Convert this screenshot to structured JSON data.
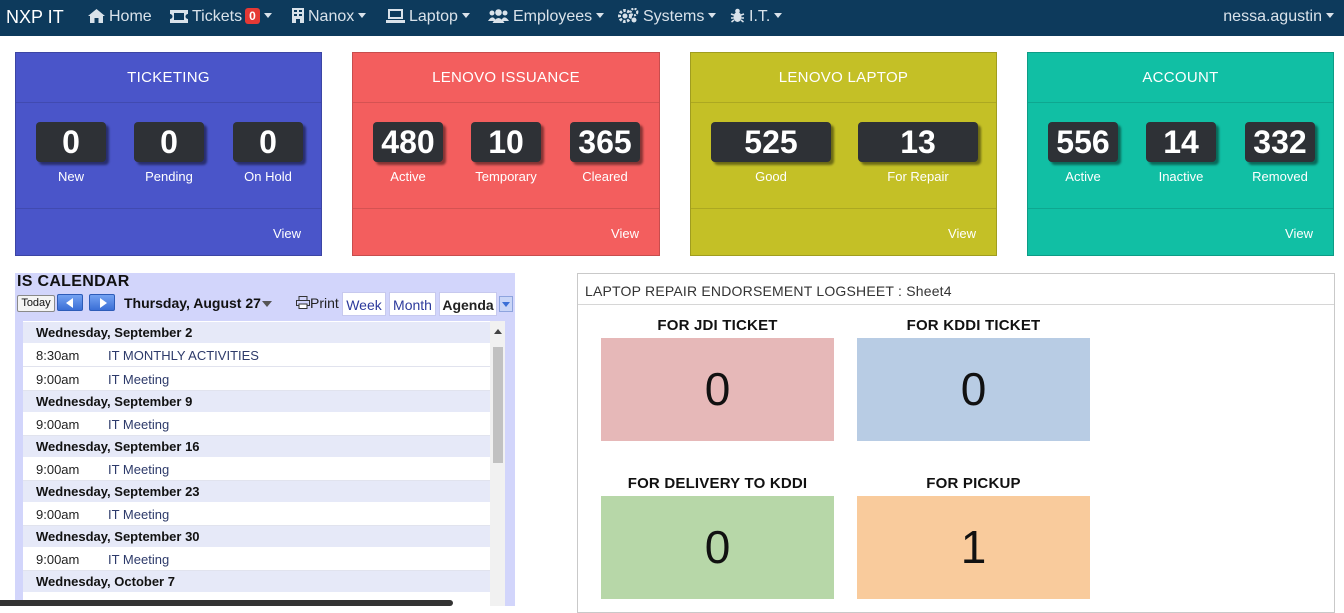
{
  "nav": {
    "brand": "NXP IT",
    "items": [
      {
        "label": "Home",
        "icon": "home-icon"
      },
      {
        "label": "Tickets",
        "icon": "ticket-icon",
        "badge": "0"
      },
      {
        "label": "Nanox",
        "icon": "building-icon"
      },
      {
        "label": "Laptop",
        "icon": "laptop-icon"
      },
      {
        "label": "Employees",
        "icon": "users-icon"
      },
      {
        "label": "Systems",
        "icon": "gears-icon"
      },
      {
        "label": "I.T.",
        "icon": "bug-icon"
      }
    ],
    "user": "nessa.agustin"
  },
  "panels": [
    {
      "title": "TICKETING",
      "color": "#4a55c9",
      "view": "View",
      "stats": [
        {
          "value": "0",
          "label": "New"
        },
        {
          "value": "0",
          "label": "Pending"
        },
        {
          "value": "0",
          "label": "On Hold"
        }
      ]
    },
    {
      "title": "LENOVO ISSUANCE",
      "color": "#f35e5e",
      "view": "View",
      "stats": [
        {
          "value": "480",
          "label": "Active"
        },
        {
          "value": "10",
          "label": "Temporary"
        },
        {
          "value": "365",
          "label": "Cleared"
        }
      ]
    },
    {
      "title": "LENOVO LAPTOP",
      "color": "#c4c026",
      "view": "View",
      "stats": [
        {
          "value": "525",
          "label": "Good"
        },
        {
          "value": "13",
          "label": "For Repair"
        }
      ]
    },
    {
      "title": "ACCOUNT",
      "color": "#11bfa4",
      "view": "View",
      "stats": [
        {
          "value": "556",
          "label": "Active"
        },
        {
          "value": "14",
          "label": "Inactive"
        },
        {
          "value": "332",
          "label": "Removed"
        }
      ]
    }
  ],
  "calendar": {
    "title": "IS CALENDAR",
    "today": "Today",
    "date": "Thursday, August 27",
    "print": "Print",
    "tabs": [
      "Week",
      "Month",
      "Agenda"
    ],
    "days": [
      {
        "day": "Wednesday, September 2",
        "events": [
          {
            "time": "8:30am",
            "title": "IT MONTHLY ACTIVITIES"
          },
          {
            "time": "9:00am",
            "title": "IT Meeting"
          }
        ]
      },
      {
        "day": "Wednesday, September 9",
        "events": [
          {
            "time": "9:00am",
            "title": "IT Meeting"
          }
        ]
      },
      {
        "day": "Wednesday, September 16",
        "events": [
          {
            "time": "9:00am",
            "title": "IT Meeting"
          }
        ]
      },
      {
        "day": "Wednesday, September 23",
        "events": [
          {
            "time": "9:00am",
            "title": "IT Meeting"
          }
        ]
      },
      {
        "day": "Wednesday, September 30",
        "events": [
          {
            "time": "9:00am",
            "title": "IT Meeting"
          }
        ]
      },
      {
        "day": "Wednesday, October 7",
        "events": []
      }
    ]
  },
  "logsheet": {
    "title": "LAPTOP REPAIR ENDORSEMENT LOGSHEET : Sheet4",
    "boxes": [
      {
        "label": "FOR JDI TICKET",
        "value": "0",
        "color": "#e6b8b8"
      },
      {
        "label": "FOR KDDI TICKET",
        "value": "0",
        "color": "#b8cce4"
      },
      {
        "label": "FOR DELIVERY TO KDDI",
        "value": "0",
        "color": "#b7d7a8"
      },
      {
        "label": "FOR PICKUP",
        "value": "1",
        "color": "#f9cb9c"
      }
    ]
  }
}
